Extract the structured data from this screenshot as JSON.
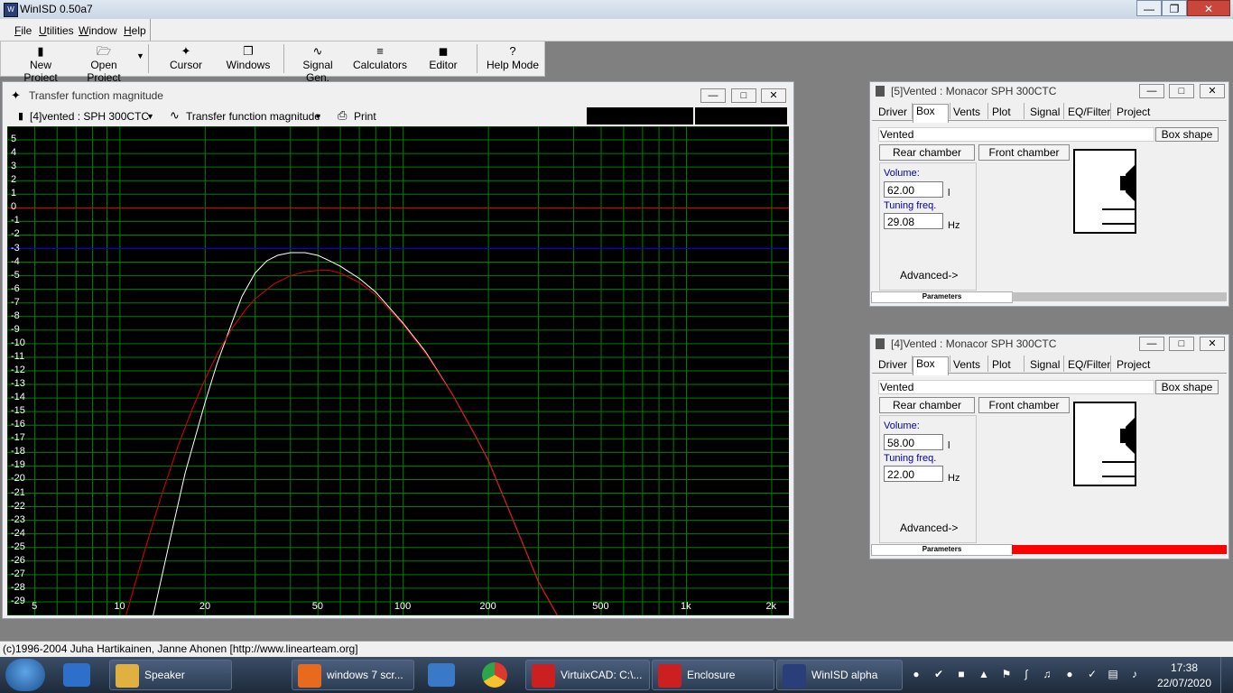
{
  "app": {
    "title": "WinISD 0.50a7"
  },
  "menu": [
    "File",
    "Utilities",
    "Window",
    "Help"
  ],
  "toolbar": [
    {
      "icon": "new-project-icon",
      "label": "New Project"
    },
    {
      "icon": "open-project-icon",
      "label": "Open Project"
    },
    {
      "icon": "cursor-icon",
      "label": "Cursor"
    },
    {
      "icon": "windows-icon",
      "label": "Windows"
    },
    {
      "icon": "signal-gen-icon",
      "label": "Signal Gen."
    },
    {
      "icon": "calculators-icon",
      "label": "Calculators"
    },
    {
      "icon": "editor-icon",
      "label": "Editor"
    },
    {
      "icon": "help-icon",
      "label": "Help Mode",
      "glyph": "?"
    }
  ],
  "graph_window": {
    "title": "Transfer function magnitude",
    "project_select": "[4]vented : SPH 300CTC",
    "plot_select": "Transfer function magnitude",
    "print_label": "Print"
  },
  "chart_data": {
    "type": "line",
    "title": "",
    "xlabel": "",
    "ylabel": "",
    "x_scale": "log",
    "xlim": [
      4,
      2300
    ],
    "ylim": [
      -30,
      6
    ],
    "x_ticks": [
      "5",
      "10",
      "20",
      "50",
      "100",
      "200",
      "500",
      "1k",
      "2k"
    ],
    "y_ticks": [
      "5",
      "4",
      "3",
      "2",
      "1",
      "0",
      "-1",
      "-2",
      "-3",
      "-4",
      "-5",
      "-6",
      "-7",
      "-8",
      "-9",
      "-10",
      "-11",
      "-12",
      "-13",
      "-14",
      "-15",
      "-16",
      "-17",
      "-18",
      "-19",
      "-20",
      "-21",
      "-22",
      "-23",
      "-24",
      "-25",
      "-26",
      "-27",
      "-28",
      "-29"
    ],
    "reference_lines": [
      {
        "y": 0,
        "color": "#e00000"
      },
      {
        "y": -3,
        "color": "#0000ff"
      }
    ],
    "series": [
      {
        "color": "#ffffff",
        "x": [
          13.1,
          15,
          17,
          20,
          22,
          25,
          27,
          30,
          33,
          36,
          40,
          45,
          50,
          55,
          60,
          70,
          80,
          100,
          120,
          150,
          180,
          200,
          250,
          300,
          350
        ],
        "y": [
          -30,
          -24.5,
          -19.5,
          -14.3,
          -11.5,
          -8.3,
          -6.5,
          -4.8,
          -3.9,
          -3.5,
          -3.3,
          -3.3,
          -3.5,
          -3.9,
          -4.3,
          -5.2,
          -6.2,
          -8.5,
          -10.6,
          -13.8,
          -16.8,
          -18.6,
          -23.5,
          -27.5,
          -30
        ]
      },
      {
        "color": "#e00000",
        "x": [
          10.5,
          12,
          14,
          16,
          18,
          20,
          22,
          25,
          28,
          30,
          35,
          40,
          45,
          50,
          55,
          60,
          70,
          80,
          100,
          120,
          150,
          180,
          200,
          250,
          300,
          350
        ],
        "y": [
          -30,
          -25.8,
          -21.2,
          -17.6,
          -14.8,
          -12.6,
          -10.8,
          -8.8,
          -7.4,
          -6.7,
          -5.6,
          -5.0,
          -4.7,
          -4.6,
          -4.6,
          -4.8,
          -5.5,
          -6.4,
          -8.6,
          -10.7,
          -13.8,
          -16.8,
          -18.6,
          -23.5,
          -27.5,
          -30
        ]
      }
    ]
  },
  "panels": [
    {
      "title": "[5]Vented : Monacor SPH 300CTC",
      "tabs": [
        "Driver",
        "Box",
        "Vents",
        "Plot",
        "Signal",
        "EQ/Filter",
        "Project"
      ],
      "box_type": "Vented",
      "box_shape_btn": "Box shape",
      "rear_chamber": "Rear chamber",
      "front_chamber": "Front chamber",
      "volume_label": "Volume:",
      "volume": "62.00",
      "volume_unit": "l",
      "tuning_label": "Tuning freq.",
      "tuning": "29.08",
      "tuning_unit": "Hz",
      "advanced": "Advanced->",
      "params_label": "Parameters",
      "params_color": "#c0c0c0"
    },
    {
      "title": "[4]Vented : Monacor SPH 300CTC",
      "tabs": [
        "Driver",
        "Box",
        "Vents",
        "Plot",
        "Signal",
        "EQ/Filter",
        "Project"
      ],
      "box_type": "Vented",
      "box_shape_btn": "Box shape",
      "rear_chamber": "Rear chamber",
      "front_chamber": "Front chamber",
      "volume_label": "Volume:",
      "volume": "58.00",
      "volume_unit": "l",
      "tuning_label": "Tuning freq.",
      "tuning": "22.00",
      "tuning_unit": "Hz",
      "advanced": "Advanced->",
      "params_label": "Parameters",
      "params_color": "#ff0000"
    }
  ],
  "status": "(c)1996-2004 Juha Hartikainen, Janne Ahonen [http://www.linearteam.org]",
  "taskbar": {
    "items": [
      {
        "label": "Speaker",
        "icon_color": "#e0b040"
      },
      {
        "label": "windows 7 scr...",
        "icon_color": "#e86a1c"
      },
      {
        "label": "VirtuixCAD: C:\\...",
        "icon_color": "#cc2020"
      },
      {
        "label": "Enclosure",
        "icon_color": "#cc2020"
      },
      {
        "label": "WinISD alpha",
        "icon_color": "#2a3f7a"
      }
    ],
    "time": "17:38",
    "date": "22/07/2020"
  }
}
